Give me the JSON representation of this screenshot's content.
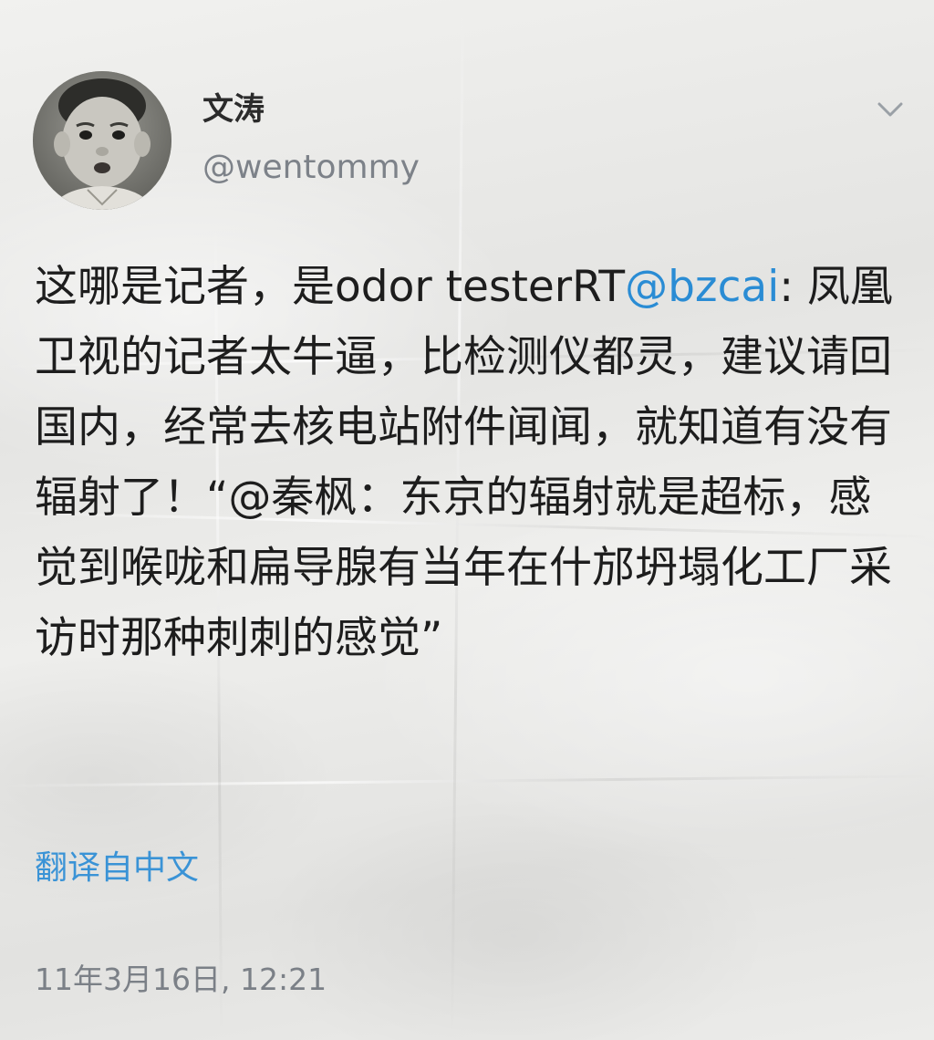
{
  "tweet": {
    "author": {
      "display_name": "文涛",
      "handle": "@wentommy",
      "avatar_icon": "avatar-photo-icon"
    },
    "menu_icon": "chevron-down-icon",
    "text": {
      "part1": "这哪是记者，是odor testerRT",
      "mention": "@bzcai",
      "part2": ": 凤凰卫视的记者太牛逼，比检测仪都灵，建议请回国内，经常去核电站附件闻闻，就知道有没有辐射了！“@秦枫：东京的辐射就是超标，感觉到喉咙和扁导腺有当年在什邡坍塌化工厂采访时那种刺刺的感觉”"
    },
    "translate_label": "翻译自中文",
    "timestamp": "11年3月16日, 12:21",
    "colors": {
      "link": "#2a8cd4",
      "text": "#1d1d1d",
      "secondary": "#7d8289"
    }
  }
}
